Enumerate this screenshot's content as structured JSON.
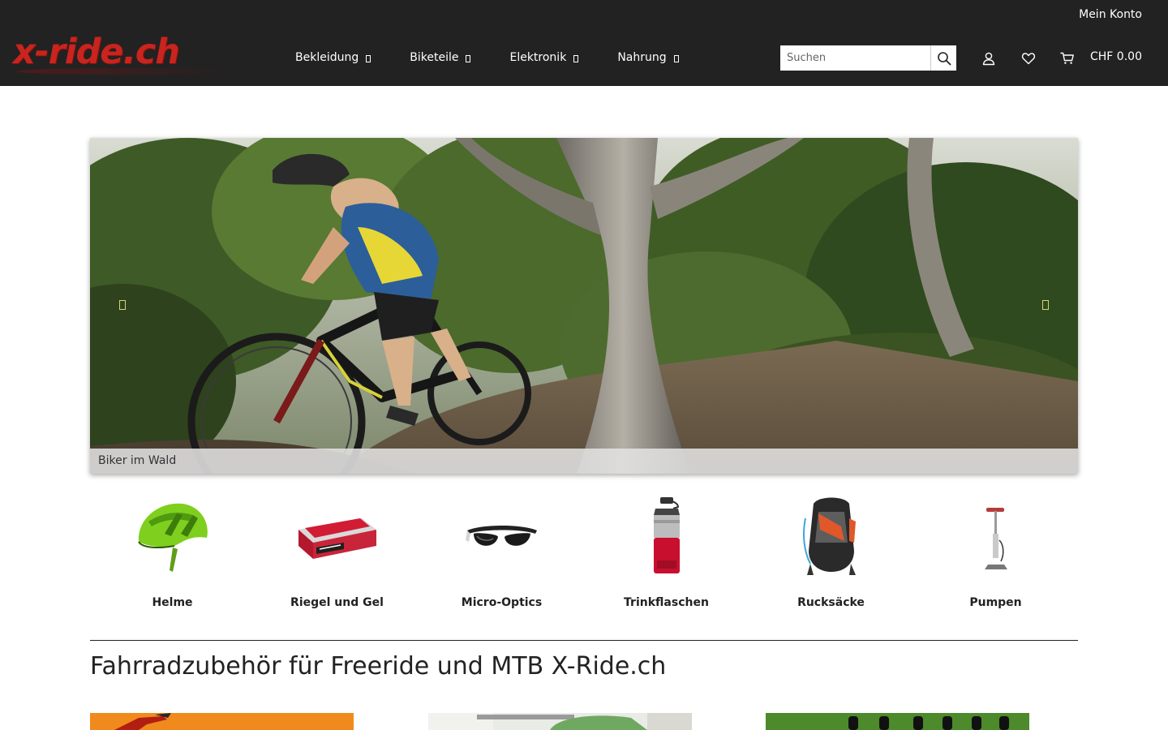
{
  "header": {
    "account_label": "Mein Konto",
    "logo_text": "x-ride.ch",
    "nav": [
      {
        "label": "Bekleidung"
      },
      {
        "label": "Biketeile"
      },
      {
        "label": "Elektronik"
      },
      {
        "label": "Nahrung"
      }
    ],
    "search": {
      "placeholder": "Suchen",
      "value": ""
    },
    "cart_total": "CHF 0.00",
    "icons": [
      "search-icon",
      "user-icon",
      "heart-icon",
      "cart-icon"
    ]
  },
  "slider": {
    "caption": "Biker im Wald"
  },
  "categories": [
    {
      "label": "Helme"
    },
    {
      "label": "Riegel und Gel"
    },
    {
      "label": "Micro-Optics"
    },
    {
      "label": "Trinkflaschen"
    },
    {
      "label": "Rucksäcke"
    },
    {
      "label": "Pumpen"
    }
  ],
  "main": {
    "headline": "Fahrradzubehör für Freeride und MTB X-Ride.ch"
  },
  "colors": {
    "header_bg": "#222222",
    "logo_red": "#c9241e",
    "text": "#222222"
  }
}
